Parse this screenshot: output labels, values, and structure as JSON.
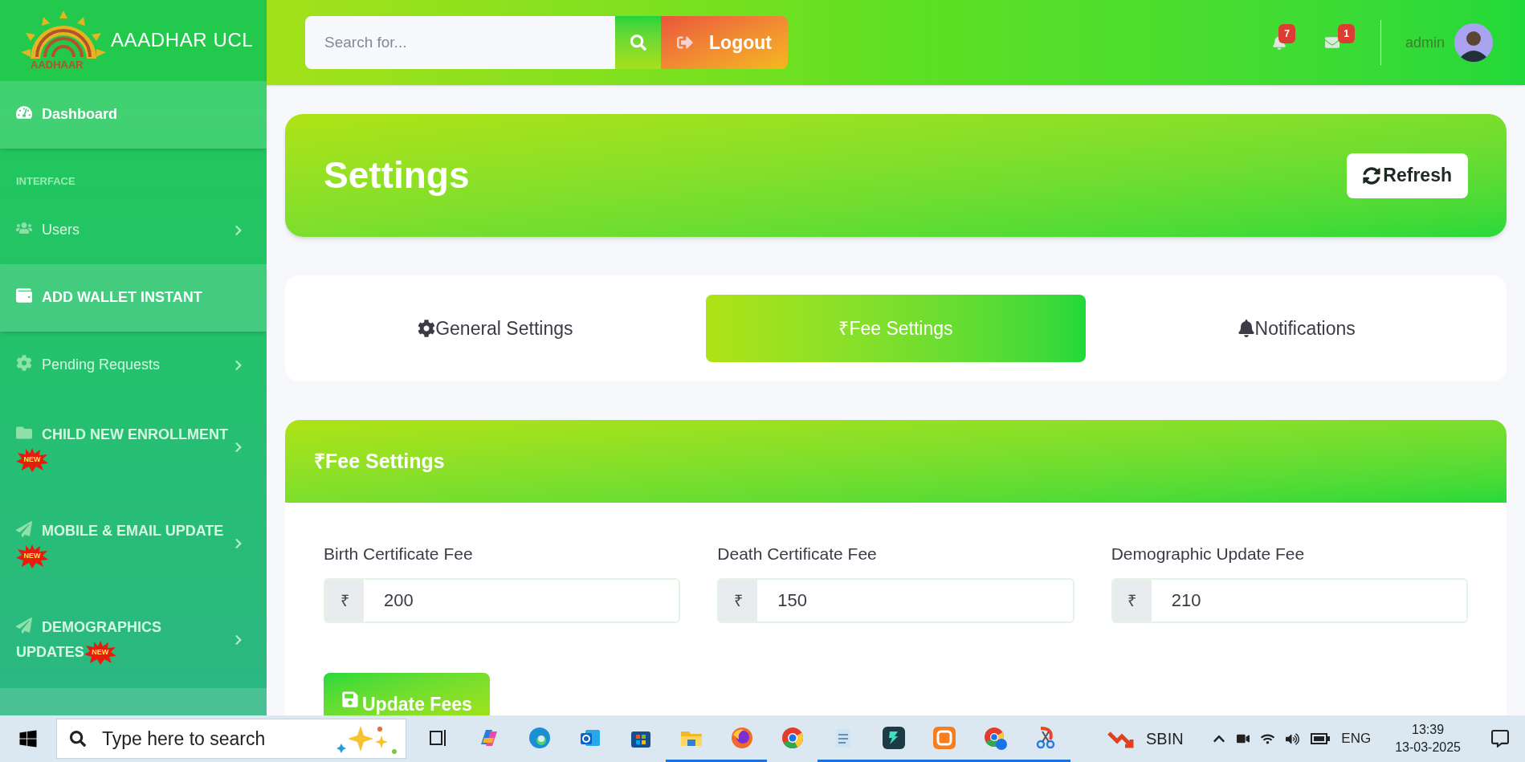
{
  "brand": {
    "name": "AAADHAR UCL",
    "logo_text": "AADHAAR"
  },
  "sidebar": {
    "items": [
      {
        "kind": "link",
        "label": "Dashboard",
        "highlighted": true
      },
      {
        "kind": "heading",
        "label": "INTERFACE"
      },
      {
        "kind": "menu",
        "label": "Users",
        "highlighted": false
      },
      {
        "kind": "link",
        "label": "ADD WALLET INSTANT",
        "highlighted": true
      },
      {
        "kind": "menu",
        "label": "Pending Requests",
        "highlighted": false
      },
      {
        "kind": "group",
        "label": "CHILD NEW ENROLLMENT",
        "badge": "NEW",
        "highlighted": false
      },
      {
        "kind": "group",
        "label": "MOBILE & EMAIL UPDATE",
        "badge": "NEW",
        "highlighted": false
      },
      {
        "kind": "group",
        "label": "DEMOGRAPHICS UPDATES",
        "badge": "NEW",
        "highlighted": false
      }
    ]
  },
  "topbar": {
    "search": {
      "placeholder": "Search for..."
    },
    "logout": "Logout",
    "alerts_count": "7",
    "messages_count": "1",
    "user": "admin"
  },
  "page": {
    "title": "Settings",
    "refresh": "Refresh"
  },
  "tabs": [
    {
      "label": "General Settings",
      "selected": false
    },
    {
      "label": "₹Fee Settings",
      "selected": true
    },
    {
      "label": "Notifications",
      "selected": false
    }
  ],
  "fee_card": {
    "title": "₹Fee Settings",
    "fields": [
      {
        "label": "Birth Certificate Fee",
        "prefix": "₹",
        "value": "200"
      },
      {
        "label": "Death Certificate Fee",
        "prefix": "₹",
        "value": "150"
      },
      {
        "label": "Demographic Update Fee",
        "prefix": "₹",
        "value": "210"
      }
    ],
    "button": "Update Fees"
  },
  "taskbar": {
    "search": {
      "placeholder": "Type here to search"
    },
    "apps": [
      {
        "kind": "taskview",
        "running": false
      },
      {
        "kind": "copilot",
        "running": false
      },
      {
        "kind": "edge",
        "running": false
      },
      {
        "kind": "outlook",
        "running": false
      },
      {
        "kind": "store",
        "running": false
      },
      {
        "kind": "explorer",
        "running": true
      },
      {
        "kind": "firefox",
        "running": true
      },
      {
        "kind": "chrome",
        "running": false
      },
      {
        "kind": "notepad",
        "running": true
      },
      {
        "kind": "filmora",
        "running": true
      },
      {
        "kind": "xampp",
        "running": true
      },
      {
        "kind": "chrome-profile",
        "running": true
      },
      {
        "kind": "snip",
        "running": true
      }
    ],
    "stock": "SBIN",
    "language": "ENG",
    "time": "13:39",
    "date": "13-03-2025"
  }
}
